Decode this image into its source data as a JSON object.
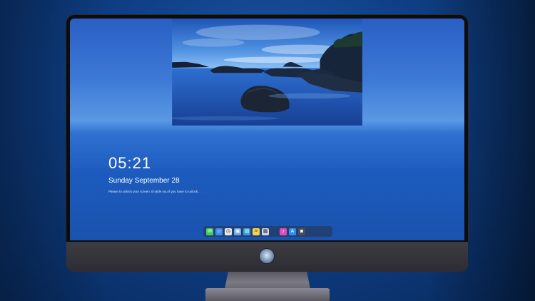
{
  "lock_screen": {
    "time": "05:21",
    "date": "Sunday September 28",
    "hint": "Please to unlock your screen. Enable you if you have to unlock..."
  },
  "dock": {
    "apps": [
      {
        "name": "messages-icon",
        "color": "#3ecf5a",
        "glyph": "✉"
      },
      {
        "name": "finder-icon",
        "color": "#3e8de8",
        "glyph": "☺"
      },
      {
        "name": "clock-icon",
        "color": "#e8e8ea",
        "glyph": "◷"
      },
      {
        "name": "preview-icon",
        "color": "#6fa8e0",
        "glyph": "▣"
      },
      {
        "name": "files-icon",
        "color": "#2f9de0",
        "glyph": "▤"
      },
      {
        "name": "notes-icon",
        "color": "#f5d34a",
        "glyph": "≡"
      },
      {
        "name": "photos-icon",
        "color": "#cfd6de",
        "glyph": "▦"
      },
      {
        "name": "music-icon",
        "color": "#e64ab8",
        "glyph": "♪"
      },
      {
        "name": "appstore-icon",
        "color": "#2e8ff0",
        "glyph": "A"
      },
      {
        "name": "camera-icon",
        "color": "#4a4d55",
        "glyph": "◙"
      }
    ]
  }
}
